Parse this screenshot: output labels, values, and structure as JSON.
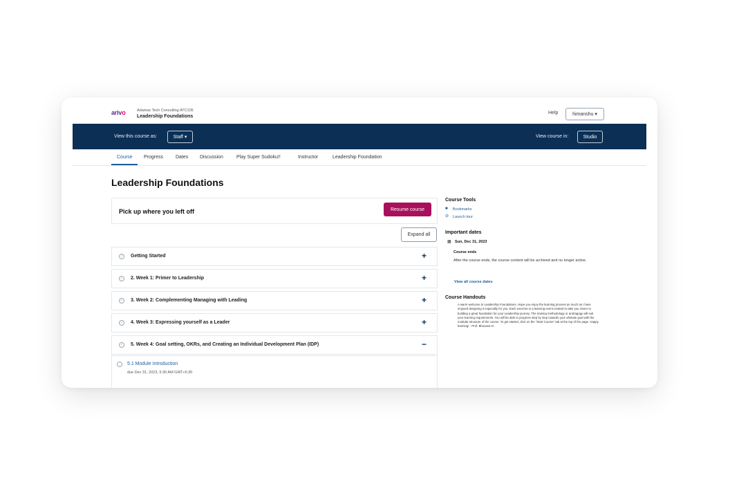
{
  "header": {
    "logo_text": "arivo",
    "logo_accent": "o",
    "org_line": "Adamas Tech Consulting ATC105",
    "course_title": "Leadership Foundations",
    "help_label": "Help",
    "user_label": "himanshu ▾"
  },
  "staff_bar": {
    "view_as_label": "View this course as:",
    "view_as_value": "Staff ▾",
    "view_in_label": "View course in:",
    "view_in_value": "Studio",
    "color": "#0b2f55"
  },
  "tabs": [
    "Course",
    "Progress",
    "Dates",
    "Discussion",
    "Play Super Sudoku!!",
    "Instructor",
    "Leadership Foundation"
  ],
  "main": {
    "page_title": "Leadership Foundations",
    "resume_heading": "Pick up where you left off",
    "resume_button": "Resume course",
    "expand_all": "Expand all",
    "sections": [
      {
        "title": "Getting Started",
        "toggle": "+"
      },
      {
        "title": "2. Week 1: Primer to Leadership",
        "toggle": "+"
      },
      {
        "title": "3. Week 2: Complementing Managing with Leading",
        "toggle": "+"
      },
      {
        "title": "4. Week 3: Expressing yourself as a Leader",
        "toggle": "+"
      },
      {
        "title": "5. Week 4: Goal setting, OKRs, and Creating an Individual Development Plan (IDP)",
        "toggle": "−"
      }
    ],
    "subsection": {
      "title": "5.1 Module Introduction",
      "due": "due Dec 31, 2023, 5:30 AM GMT+5:30"
    }
  },
  "sidebar": {
    "tools_heading": "Course Tools",
    "bookmarks": "Bookmarks",
    "launch_tour": "Launch tour",
    "dates_heading": "Important dates",
    "date": "Sun, Dec 31, 2023",
    "course_ends": "Course ends",
    "ends_text": "After the course ends, the course content will be archived and no longer active.",
    "view_all_dates": "View all course dates",
    "handouts_heading": "Course Handouts",
    "handouts_text": "A warm welcome to Leadership Foundations. Hope you enjoy the learning process as much as I have enjoyed designing it especially for you. Each exercise is a learning event created to take you closer to building a great foundation for your Leadership journey. The training methodology or andragogy will suit your learning requirements. You will be able to progress step by step towards your ultimate goal with the modular structure of the course. To get started, click on the \"Start Course\" tab at the top of the page. Happy learning! - Prof. Bhuvana N"
  },
  "colors": {
    "brand_navy": "#0b2f55",
    "resume_button": "#a8105b",
    "link": "#1f5c99"
  }
}
